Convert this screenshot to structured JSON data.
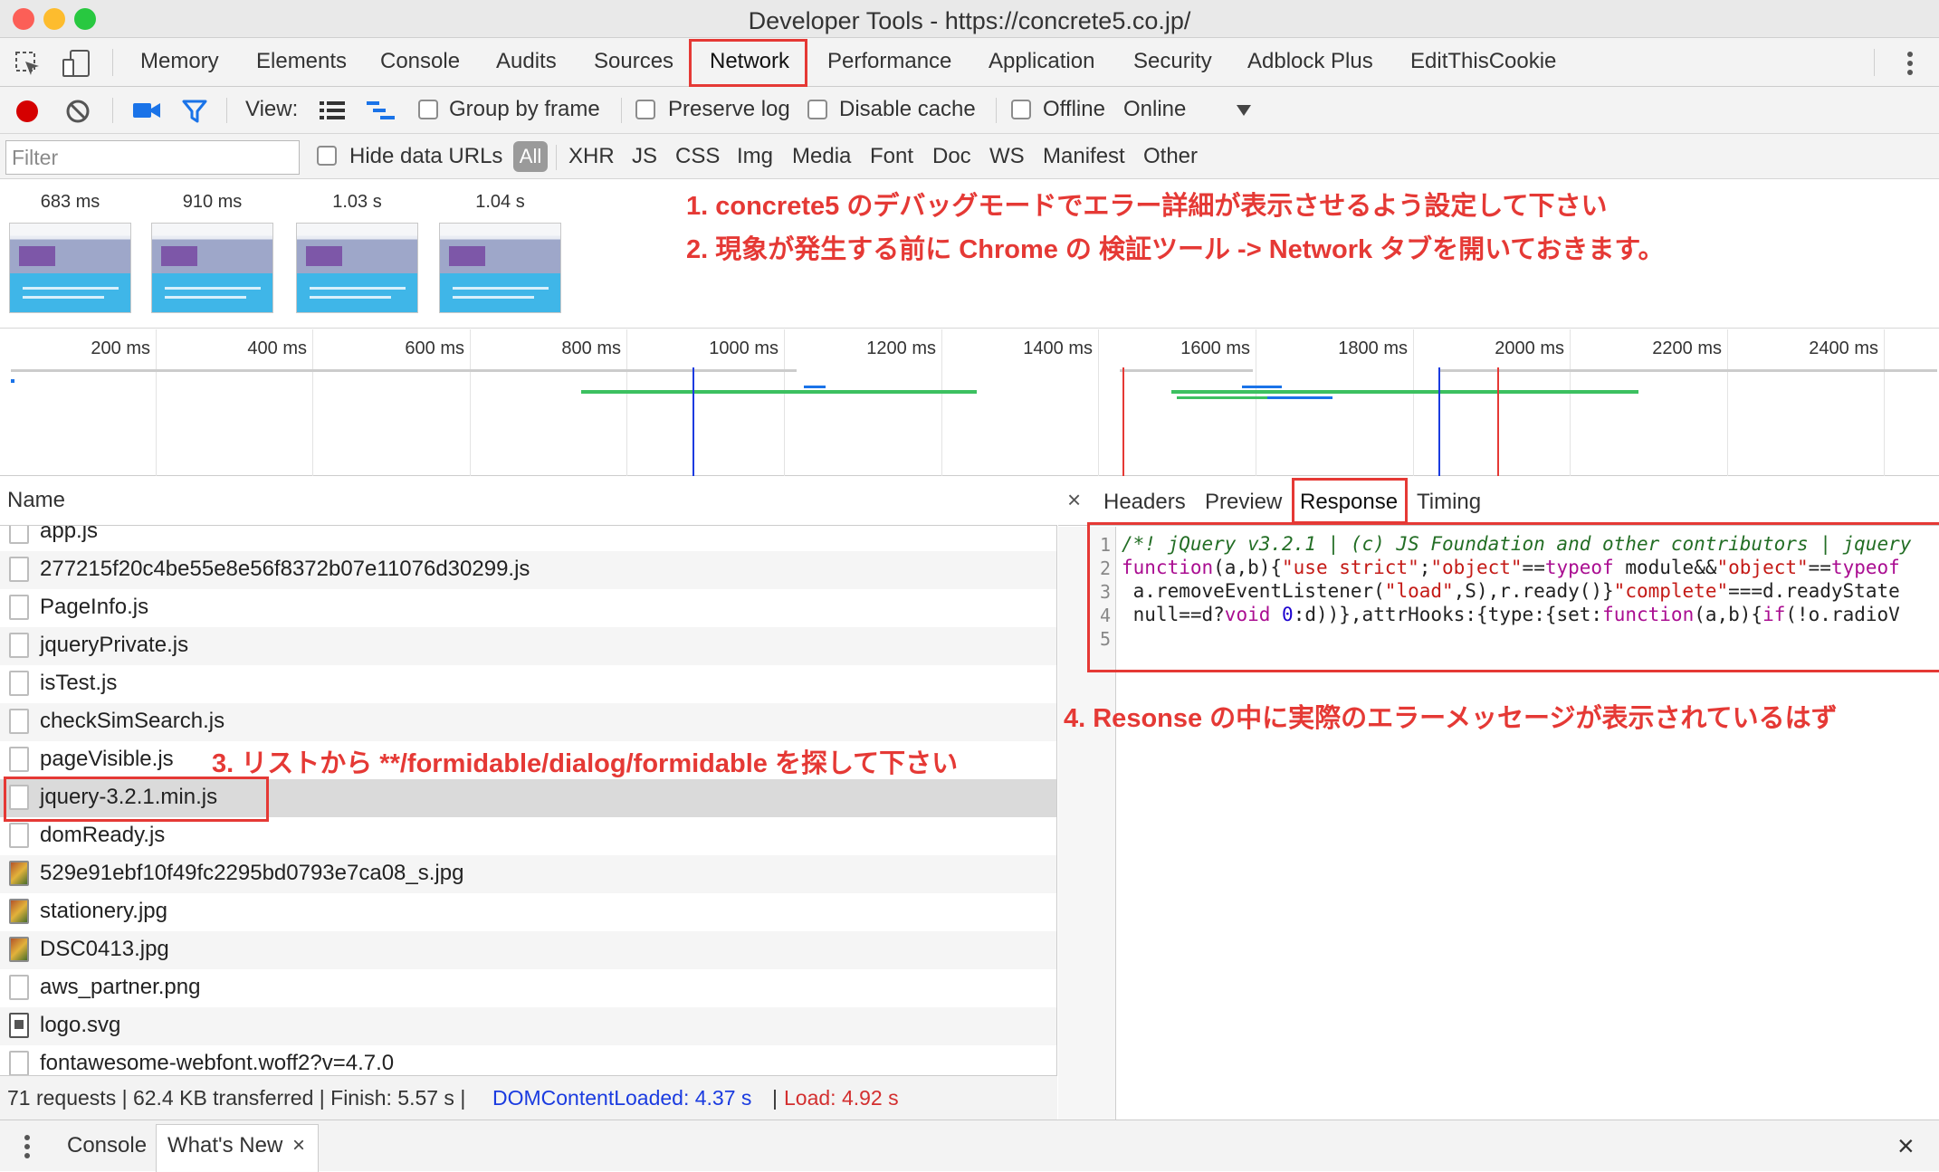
{
  "window": {
    "title": "Developer Tools - https://concrete5.co.jp/"
  },
  "colors": {
    "annotation": "#e53935",
    "selected_tab": "#e53935",
    "record": "#d50000",
    "dcl": "#1a3be0",
    "load": "#d32f2f"
  },
  "main_tabs": [
    "Memory",
    "Elements",
    "Console",
    "Audits",
    "Sources",
    "Network",
    "Performance",
    "Application",
    "Security",
    "Adblock Plus",
    "EditThisCookie"
  ],
  "toolbar": {
    "view_label": "View:",
    "group_by_frame": "Group by frame",
    "preserve_log": "Preserve log",
    "disable_cache": "Disable cache",
    "offline": "Offline",
    "throttle_value": "Online"
  },
  "filter": {
    "placeholder": "Filter",
    "hide_data_urls": "Hide data URLs",
    "types": [
      "All",
      "XHR",
      "JS",
      "CSS",
      "Img",
      "Media",
      "Font",
      "Doc",
      "WS",
      "Manifest",
      "Other"
    ]
  },
  "screenshots": [
    {
      "time": "683 ms"
    },
    {
      "time": "910 ms"
    },
    {
      "time": "1.03 s"
    },
    {
      "time": "1.04 s"
    }
  ],
  "annotations": {
    "a1": "1. concrete5 のデバッグモードでエラー詳細が表示させるよう設定して下さい",
    "a2": "2. 現象が発生する前に Chrome の 検証ツール -> Network タブを開いておきます。",
    "a3": "3. リストから **/formidable/dialog/formidable を探して下さい",
    "a4": "4. Resonse の中に実際のエラーメッセージが表示されているはず"
  },
  "overview": {
    "ticks": [
      "200 ms",
      "400 ms",
      "600 ms",
      "800 ms",
      "1000 ms",
      "1200 ms",
      "1400 ms",
      "1600 ms",
      "1800 ms",
      "2000 ms",
      "2200 ms",
      "2400 ms"
    ]
  },
  "requests": {
    "header": "Name",
    "rows": [
      {
        "name": "app.js",
        "icon": "file"
      },
      {
        "name": "277215f20c4be55e8e56f8372b07e11076d30299.js",
        "icon": "file"
      },
      {
        "name": "PageInfo.js",
        "icon": "file"
      },
      {
        "name": "jqueryPrivate.js",
        "icon": "file"
      },
      {
        "name": "isTest.js",
        "icon": "file"
      },
      {
        "name": "checkSimSearch.js",
        "icon": "file"
      },
      {
        "name": "pageVisible.js",
        "icon": "file"
      },
      {
        "name": "jquery-3.2.1.min.js",
        "icon": "file"
      },
      {
        "name": "domReady.js",
        "icon": "file"
      },
      {
        "name": "529e91ebf10f49fc2295bd0793e7ca08_s.jpg",
        "icon": "image"
      },
      {
        "name": "stationery.jpg",
        "icon": "image"
      },
      {
        "name": "DSC0413.jpg",
        "icon": "image"
      },
      {
        "name": "aws_partner.png",
        "icon": "file"
      },
      {
        "name": "logo.svg",
        "icon": "svg"
      },
      {
        "name": "fontawesome-webfont.woff2?v=4.7.0",
        "icon": "file"
      }
    ]
  },
  "status": {
    "summary": "71 requests | 62.4 KB transferred | Finish: 5.57 s |",
    "dcl": "DOMContentLoaded: 4.37 s",
    "sep": "|",
    "load": "Load: 4.92 s"
  },
  "details": {
    "close": "×",
    "tabs": [
      "Headers",
      "Preview",
      "Response",
      "Timing"
    ],
    "line_numbers": [
      "1",
      "2",
      "3",
      "4",
      "5"
    ],
    "code": {
      "l1": "/*! jQuery v3.2.1 | (c) JS Foundation and other contributors | jquery",
      "l2a": "function",
      "l2b": "(a,b){",
      "l2c": "\"use strict\"",
      "l2d": ";",
      "l2e": "\"object\"",
      "l2f": "==",
      "l2g": "typeof",
      "l2h": " module&&",
      "l2i": "\"object\"",
      "l2j": "==",
      "l2k": "typeof",
      "l3a": " a.removeEventListener(",
      "l3b": "\"load\"",
      "l3c": ",S),r.ready()}",
      "l3d": "\"complete\"",
      "l3e": "===d.readyState",
      "l4a": " null==d?",
      "l4b": "void",
      "l4c": " ",
      "l4d": "0",
      "l4e": ":d))},attrHooks:{type:{set:",
      "l4f": "function",
      "l4g": "(a,b){",
      "l4h": "if",
      "l4i": "(!o.radioV"
    }
  },
  "drawer": {
    "tabs": [
      "Console",
      "What's New"
    ],
    "close": "×"
  }
}
